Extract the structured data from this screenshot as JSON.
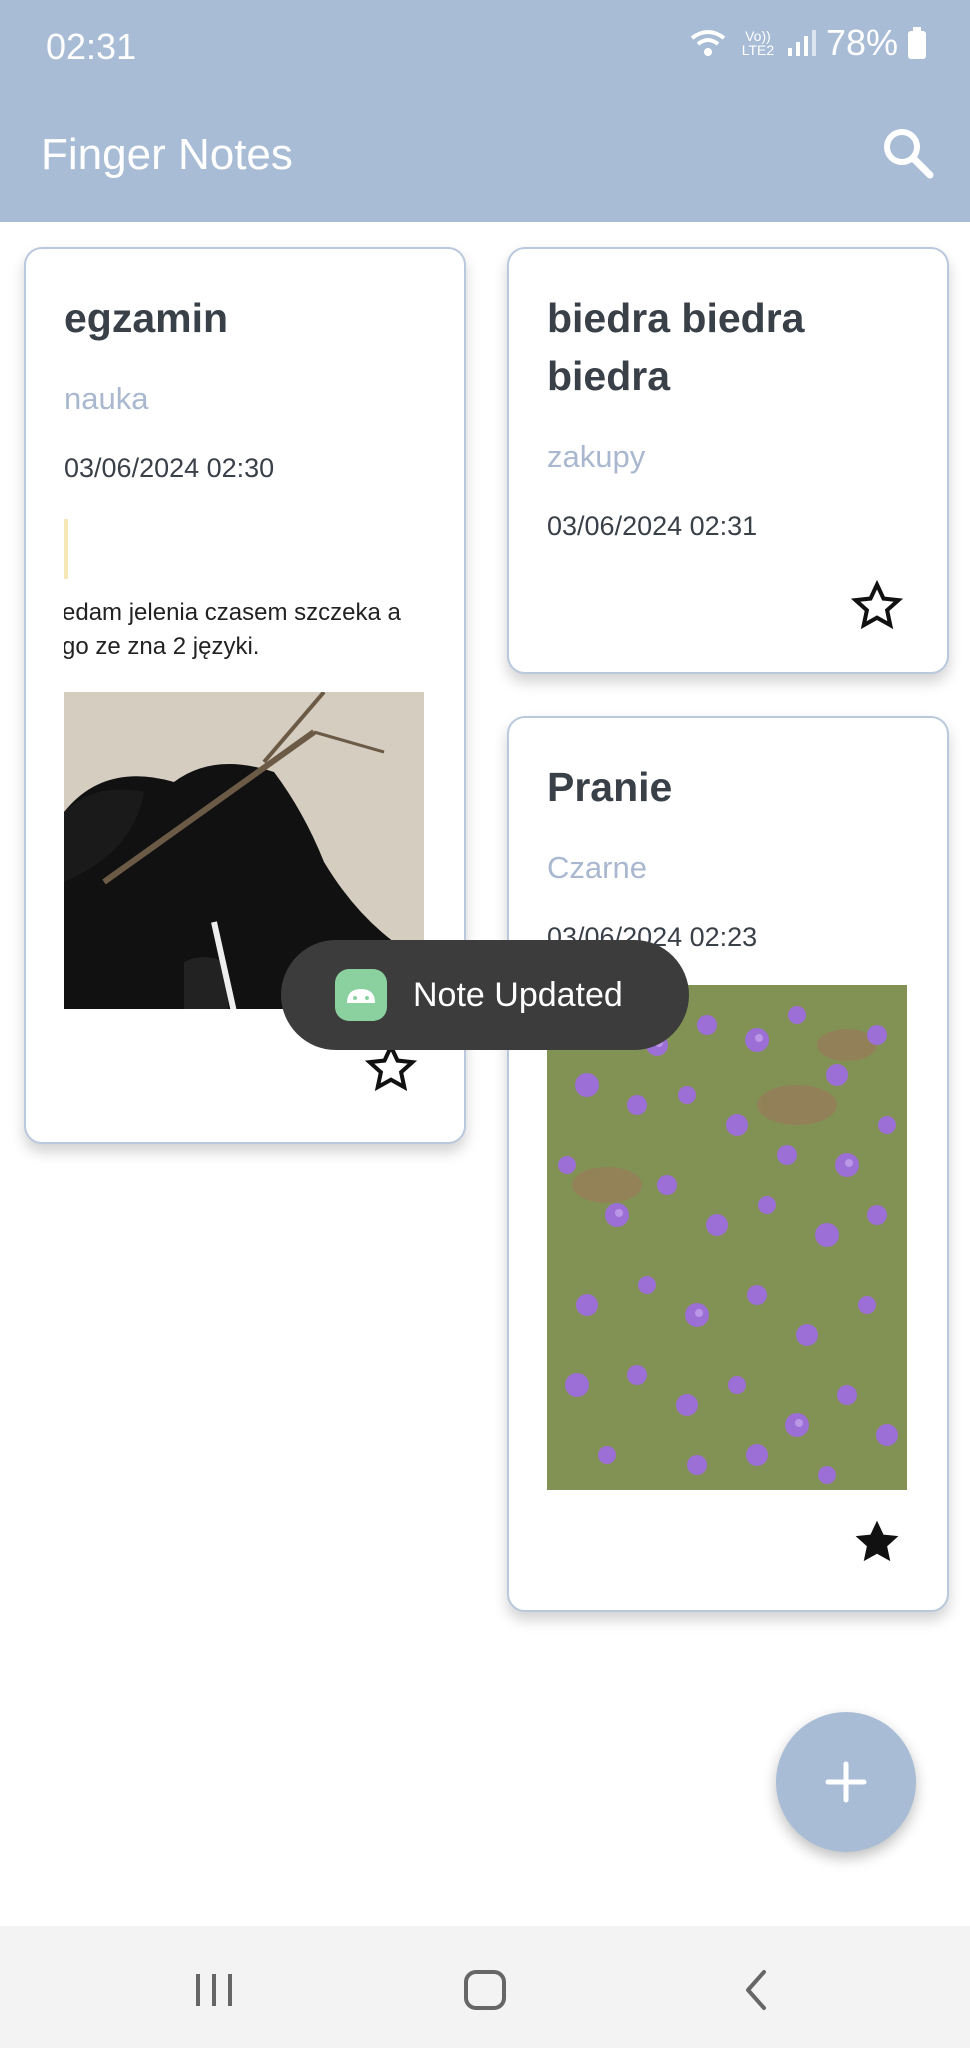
{
  "status_bar": {
    "time": "02:31",
    "network": "Vo)) LTE2",
    "battery": "78%"
  },
  "app": {
    "title": "Finger Notes"
  },
  "notes": [
    {
      "title": "egzamin",
      "category": "nauka",
      "date": "03/06/2024 02:30",
      "meme_text_line1": "edam jelenia czasem szczeka a",
      "meme_text_line2": "go ze zna 2 języki.",
      "favorite": false
    },
    {
      "title_line1": "biedra biedra",
      "title_line2": "biedra",
      "category": "zakupy",
      "date": "03/06/2024 02:31",
      "favorite": false
    },
    {
      "title": "Pranie",
      "category": "Czarne",
      "date": "03/06/2024 02:23",
      "favorite": true
    }
  ],
  "toast": {
    "text": "Note Updated"
  },
  "colors": {
    "primary": "#a8bcd6",
    "category": "#a9b8cf",
    "text": "#3a4048"
  }
}
